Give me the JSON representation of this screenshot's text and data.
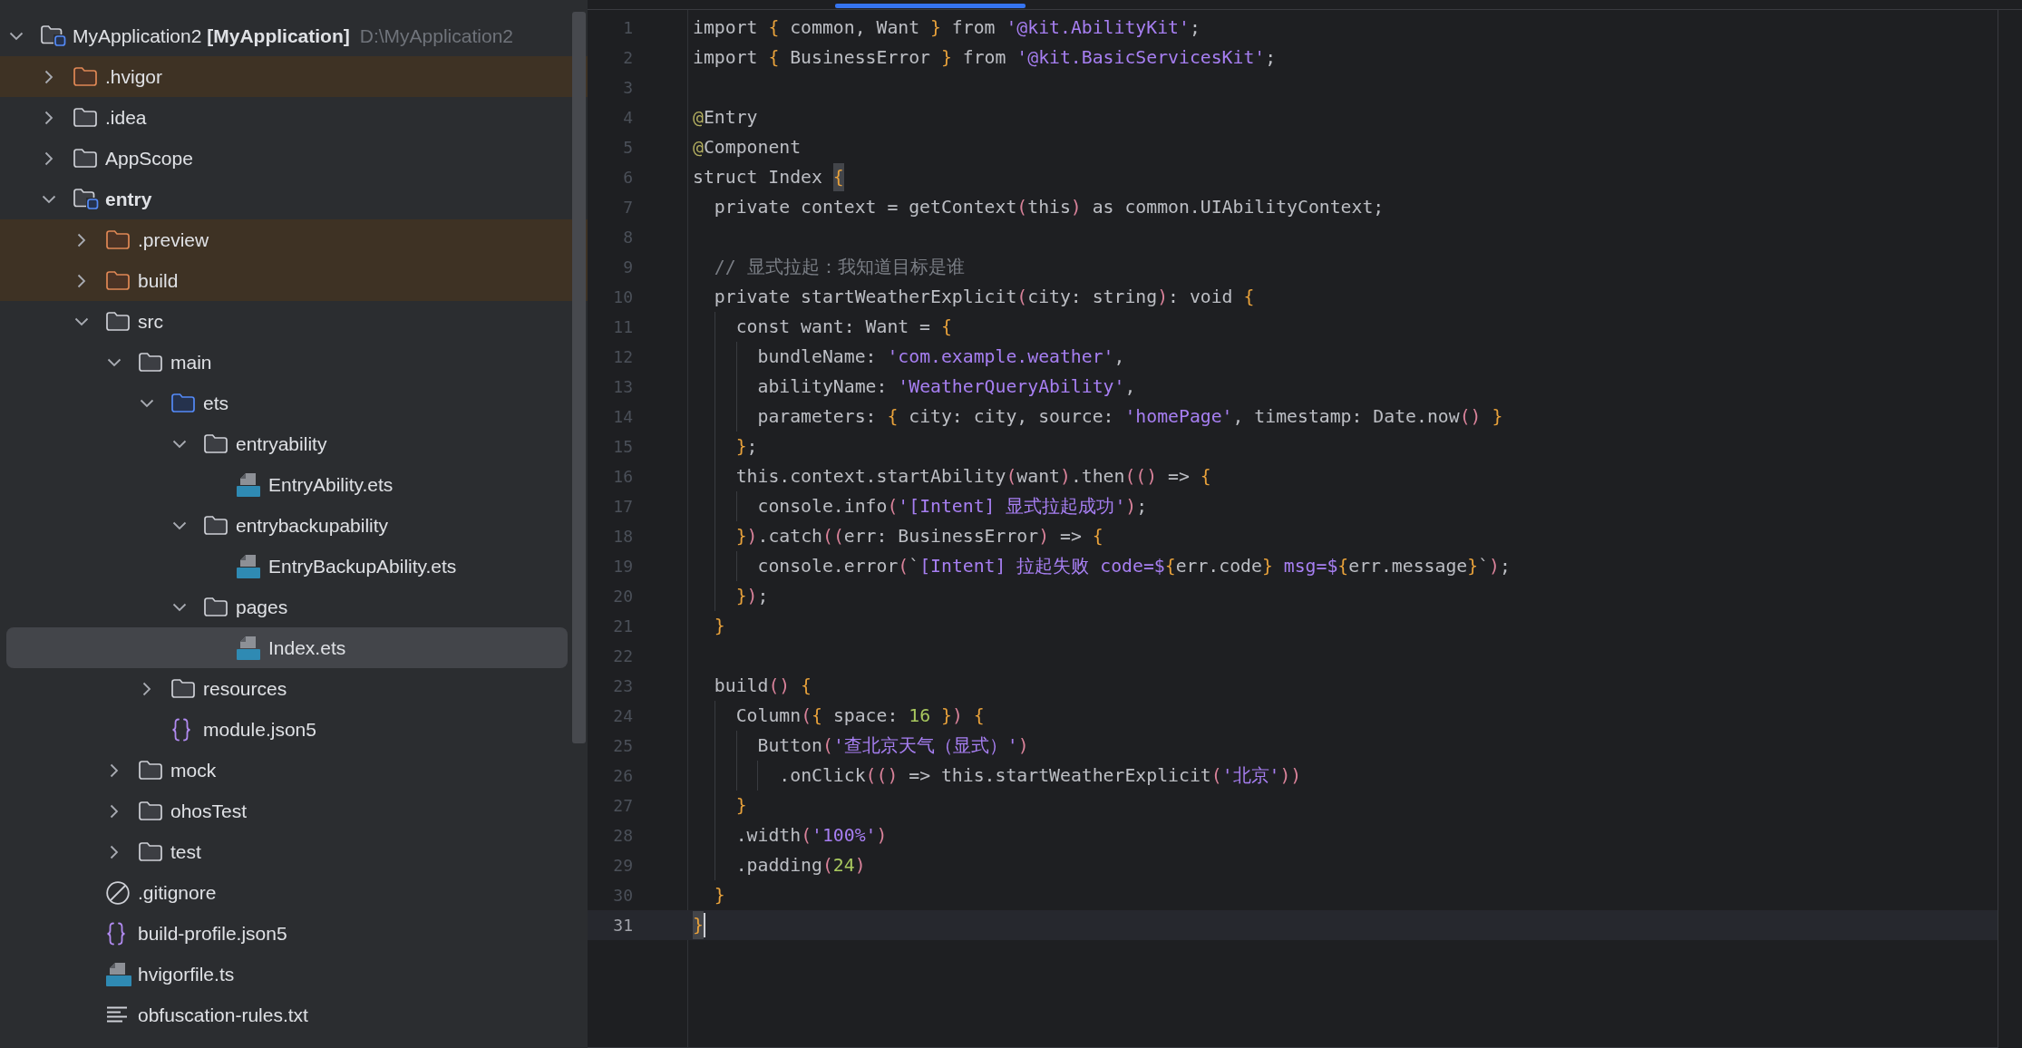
{
  "project_tree": {
    "kind": "project",
    "label": "MyApplication2 **[MyApplication]**",
    "path": "D:\\MyApplication2",
    "expanded": true,
    "selected": false,
    "excluded": false,
    "children": [
      {
        "kind": "folder",
        "label": ".hvigor",
        "expanded": false,
        "selected": false,
        "excluded": true
      },
      {
        "kind": "folder",
        "label": ".idea",
        "expanded": false,
        "selected": false,
        "excluded": false
      },
      {
        "kind": "folder",
        "label": "AppScope",
        "expanded": false,
        "selected": false,
        "excluded": false
      },
      {
        "kind": "module",
        "label": "entry",
        "expanded": true,
        "selected": false,
        "excluded": false,
        "children": [
          {
            "kind": "folder",
            "label": ".preview",
            "expanded": false,
            "selected": false,
            "excluded": true
          },
          {
            "kind": "folder",
            "label": "build",
            "expanded": false,
            "selected": false,
            "excluded": true
          },
          {
            "kind": "folder",
            "label": "src",
            "expanded": true,
            "selected": false,
            "excluded": false,
            "children": [
              {
                "kind": "folder",
                "label": "main",
                "expanded": true,
                "selected": false,
                "excluded": false,
                "children": [
                  {
                    "kind": "source-folder",
                    "label": "ets",
                    "expanded": true,
                    "selected": false,
                    "excluded": false,
                    "children": [
                      {
                        "kind": "folder",
                        "label": "entryability",
                        "expanded": true,
                        "selected": false,
                        "excluded": false,
                        "children": [
                          {
                            "kind": "ets-file",
                            "label": "EntryAbility.ets",
                            "selected": false,
                            "excluded": false
                          }
                        ]
                      },
                      {
                        "kind": "folder",
                        "label": "entrybackupability",
                        "expanded": true,
                        "selected": false,
                        "excluded": false,
                        "children": [
                          {
                            "kind": "ets-file",
                            "label": "EntryBackupAbility.ets",
                            "selected": false,
                            "excluded": false
                          }
                        ]
                      },
                      {
                        "kind": "folder",
                        "label": "pages",
                        "expanded": true,
                        "selected": false,
                        "excluded": false,
                        "children": [
                          {
                            "kind": "ets-file",
                            "label": "Index.ets",
                            "selected": true,
                            "excluded": false
                          }
                        ]
                      }
                    ]
                  },
                  {
                    "kind": "folder",
                    "label": "resources",
                    "expanded": false,
                    "selected": false,
                    "excluded": false
                  },
                  {
                    "kind": "json-file",
                    "label": "module.json5",
                    "selected": false,
                    "excluded": false
                  }
                ]
              },
              {
                "kind": "folder",
                "label": "mock",
                "expanded": false,
                "selected": false,
                "excluded": false
              },
              {
                "kind": "folder",
                "label": "ohosTest",
                "expanded": false,
                "selected": false,
                "excluded": false
              },
              {
                "kind": "folder",
                "label": "test",
                "expanded": false,
                "selected": false,
                "excluded": false
              }
            ]
          },
          {
            "kind": "ignore-file",
            "label": ".gitignore",
            "selected": false,
            "excluded": false
          },
          {
            "kind": "json-file",
            "label": "build-profile.json5",
            "selected": false,
            "excluded": false
          },
          {
            "kind": "ts-file",
            "label": "hvigorfile.ts",
            "selected": false,
            "excluded": false
          },
          {
            "kind": "text-file",
            "label": "obfuscation-rules.txt",
            "selected": false,
            "excluded": false
          }
        ]
      }
    ]
  },
  "editor": {
    "lines": [
      {
        "number": "1",
        "current": false,
        "tokens": [
          {
            "text": "import ",
            "kind": "plain"
          },
          {
            "text": "{",
            "kind": "brace"
          },
          {
            "text": " common, Want ",
            "kind": "plain"
          },
          {
            "text": "}",
            "kind": "brace"
          },
          {
            "text": " from ",
            "kind": "plain"
          },
          {
            "text": "'@kit.AbilityKit'",
            "kind": "string"
          },
          {
            "text": ";",
            "kind": "plain"
          }
        ]
      },
      {
        "number": "2",
        "current": false,
        "tokens": [
          {
            "text": "import ",
            "kind": "plain"
          },
          {
            "text": "{",
            "kind": "brace"
          },
          {
            "text": " BusinessError ",
            "kind": "plain"
          },
          {
            "text": "}",
            "kind": "brace"
          },
          {
            "text": " from ",
            "kind": "plain"
          },
          {
            "text": "'@kit.BasicServicesKit'",
            "kind": "string"
          },
          {
            "text": ";",
            "kind": "plain"
          }
        ]
      },
      {
        "number": "3",
        "current": false
      },
      {
        "number": "4",
        "current": false,
        "tokens": [
          {
            "text": "@",
            "kind": "annotation"
          },
          {
            "text": "Entry",
            "kind": "plain"
          }
        ]
      },
      {
        "number": "5",
        "current": false,
        "tokens": [
          {
            "text": "@",
            "kind": "annotation"
          },
          {
            "text": "Component",
            "kind": "plain"
          }
        ]
      },
      {
        "number": "6",
        "current": false,
        "tokens": [
          {
            "text": "struct Index ",
            "kind": "plain"
          },
          {
            "text": "{",
            "kind": "match"
          }
        ]
      },
      {
        "number": "7",
        "current": false,
        "tokens": [
          {
            "text": "  private context = getContext",
            "kind": "plain"
          },
          {
            "text": "(",
            "kind": "paren"
          },
          {
            "text": "this",
            "kind": "plain"
          },
          {
            "text": ")",
            "kind": "paren"
          },
          {
            "text": " as common.UIAbilityContext;",
            "kind": "plain"
          }
        ]
      },
      {
        "number": "8",
        "current": false
      },
      {
        "number": "9",
        "current": false,
        "tokens": [
          {
            "text": "  // 显式拉起：我知道目标是谁",
            "kind": "comment"
          }
        ]
      },
      {
        "number": "10",
        "current": false,
        "tokens": [
          {
            "text": "  private startWeatherExplicit",
            "kind": "plain"
          },
          {
            "text": "(",
            "kind": "paren"
          },
          {
            "text": "city: string",
            "kind": "plain"
          },
          {
            "text": ")",
            "kind": "paren"
          },
          {
            "text": ": void ",
            "kind": "plain"
          },
          {
            "text": "{",
            "kind": "brace"
          }
        ]
      },
      {
        "number": "11",
        "current": false,
        "tokens": [
          {
            "text": "    const want: Want = ",
            "kind": "plain"
          },
          {
            "text": "{",
            "kind": "brace"
          }
        ]
      },
      {
        "number": "12",
        "current": false,
        "tokens": [
          {
            "text": "      bundleName: ",
            "kind": "plain"
          },
          {
            "text": "'com.example.weather'",
            "kind": "string"
          },
          {
            "text": ",",
            "kind": "plain"
          }
        ]
      },
      {
        "number": "13",
        "current": false,
        "tokens": [
          {
            "text": "      abilityName: ",
            "kind": "plain"
          },
          {
            "text": "'WeatherQueryAbility'",
            "kind": "string"
          },
          {
            "text": ",",
            "kind": "plain"
          }
        ]
      },
      {
        "number": "14",
        "current": false,
        "tokens": [
          {
            "text": "      parameters: ",
            "kind": "plain"
          },
          {
            "text": "{",
            "kind": "brace"
          },
          {
            "text": " city: city, source: ",
            "kind": "plain"
          },
          {
            "text": "'homePage'",
            "kind": "string"
          },
          {
            "text": ", timestamp: Date.now",
            "kind": "plain"
          },
          {
            "text": "()",
            "kind": "paren"
          },
          {
            "text": " }",
            "kind": "brace"
          }
        ]
      },
      {
        "number": "15",
        "current": false,
        "tokens": [
          {
            "text": "    }",
            "kind": "brace"
          },
          {
            "text": ";",
            "kind": "plain"
          }
        ]
      },
      {
        "number": "16",
        "current": false,
        "tokens": [
          {
            "text": "    this.context.startAbility",
            "kind": "plain"
          },
          {
            "text": "(",
            "kind": "paren"
          },
          {
            "text": "want",
            "kind": "plain"
          },
          {
            "text": ")",
            "kind": "paren"
          },
          {
            "text": ".then",
            "kind": "plain"
          },
          {
            "text": "(()",
            "kind": "paren"
          },
          {
            "text": " => ",
            "kind": "plain"
          },
          {
            "text": "{",
            "kind": "brace"
          }
        ]
      },
      {
        "number": "17",
        "current": false,
        "tokens": [
          {
            "text": "      console.info",
            "kind": "plain"
          },
          {
            "text": "(",
            "kind": "paren"
          },
          {
            "text": "'[Intent] 显式拉起成功'",
            "kind": "string"
          },
          {
            "text": ")",
            "kind": "paren"
          },
          {
            "text": ";",
            "kind": "plain"
          }
        ]
      },
      {
        "number": "18",
        "current": false,
        "tokens": [
          {
            "text": "    }",
            "kind": "brace"
          },
          {
            "text": ")",
            "kind": "paren"
          },
          {
            "text": ".catch",
            "kind": "plain"
          },
          {
            "text": "((",
            "kind": "paren"
          },
          {
            "text": "err: BusinessError",
            "kind": "plain"
          },
          {
            "text": ")",
            "kind": "paren"
          },
          {
            "text": " => ",
            "kind": "plain"
          },
          {
            "text": "{",
            "kind": "brace"
          }
        ]
      },
      {
        "number": "19",
        "current": false,
        "tokens": [
          {
            "text": "      console.error",
            "kind": "plain"
          },
          {
            "text": "(",
            "kind": "paren"
          },
          {
            "text": "`",
            "kind": "plain"
          },
          {
            "text": "[Intent] 拉起失败 code=$",
            "kind": "string"
          },
          {
            "text": "{",
            "kind": "brace"
          },
          {
            "text": "err.code",
            "kind": "plain"
          },
          {
            "text": "}",
            "kind": "brace"
          },
          {
            "text": " msg=$",
            "kind": "string"
          },
          {
            "text": "{",
            "kind": "brace"
          },
          {
            "text": "err.message",
            "kind": "plain"
          },
          {
            "text": "}",
            "kind": "brace"
          },
          {
            "text": "`",
            "kind": "plain"
          },
          {
            "text": ")",
            "kind": "paren"
          },
          {
            "text": ";",
            "kind": "plain"
          }
        ]
      },
      {
        "number": "20",
        "current": false,
        "tokens": [
          {
            "text": "    }",
            "kind": "brace"
          },
          {
            "text": ")",
            "kind": "paren"
          },
          {
            "text": ";",
            "kind": "plain"
          }
        ]
      },
      {
        "number": "21",
        "current": false,
        "tokens": [
          {
            "text": "  }",
            "kind": "brace"
          }
        ]
      },
      {
        "number": "22",
        "current": false
      },
      {
        "number": "23",
        "current": false,
        "tokens": [
          {
            "text": "  build",
            "kind": "plain"
          },
          {
            "text": "()",
            "kind": "paren"
          },
          {
            "text": " {",
            "kind": "brace"
          }
        ]
      },
      {
        "number": "24",
        "current": false,
        "tokens": [
          {
            "text": "    Column",
            "kind": "plain"
          },
          {
            "text": "(",
            "kind": "paren"
          },
          {
            "text": "{",
            "kind": "brace"
          },
          {
            "text": " space: ",
            "kind": "plain"
          },
          {
            "text": "16",
            "kind": "number"
          },
          {
            "text": " }",
            "kind": "brace"
          },
          {
            "text": ")",
            "kind": "paren"
          },
          {
            "text": " {",
            "kind": "brace"
          }
        ]
      },
      {
        "number": "25",
        "current": false,
        "tokens": [
          {
            "text": "      Button",
            "kind": "plain"
          },
          {
            "text": "(",
            "kind": "paren"
          },
          {
            "text": "'查北京天气（显式）'",
            "kind": "string"
          },
          {
            "text": ")",
            "kind": "paren"
          }
        ]
      },
      {
        "number": "26",
        "current": false,
        "tokens": [
          {
            "text": "        .onClick",
            "kind": "plain"
          },
          {
            "text": "(()",
            "kind": "paren"
          },
          {
            "text": " => this.startWeatherExplicit",
            "kind": "plain"
          },
          {
            "text": "(",
            "kind": "paren"
          },
          {
            "text": "'北京'",
            "kind": "string"
          },
          {
            "text": "))",
            "kind": "paren"
          }
        ]
      },
      {
        "number": "27",
        "current": false,
        "tokens": [
          {
            "text": "    }",
            "kind": "brace"
          }
        ]
      },
      {
        "number": "28",
        "current": false,
        "tokens": [
          {
            "text": "    .width",
            "kind": "plain"
          },
          {
            "text": "(",
            "kind": "paren"
          },
          {
            "text": "'100%'",
            "kind": "string"
          },
          {
            "text": ")",
            "kind": "paren"
          }
        ]
      },
      {
        "number": "29",
        "current": false,
        "tokens": [
          {
            "text": "    .padding",
            "kind": "plain"
          },
          {
            "text": "(",
            "kind": "paren"
          },
          {
            "text": "24",
            "kind": "number"
          },
          {
            "text": ")",
            "kind": "paren"
          }
        ]
      },
      {
        "number": "30",
        "current": false,
        "tokens": [
          {
            "text": "  }",
            "kind": "brace"
          }
        ]
      },
      {
        "number": "31",
        "current": true,
        "tokens": [
          {
            "text": "}",
            "kind": "match"
          }
        ]
      }
    ]
  }
}
